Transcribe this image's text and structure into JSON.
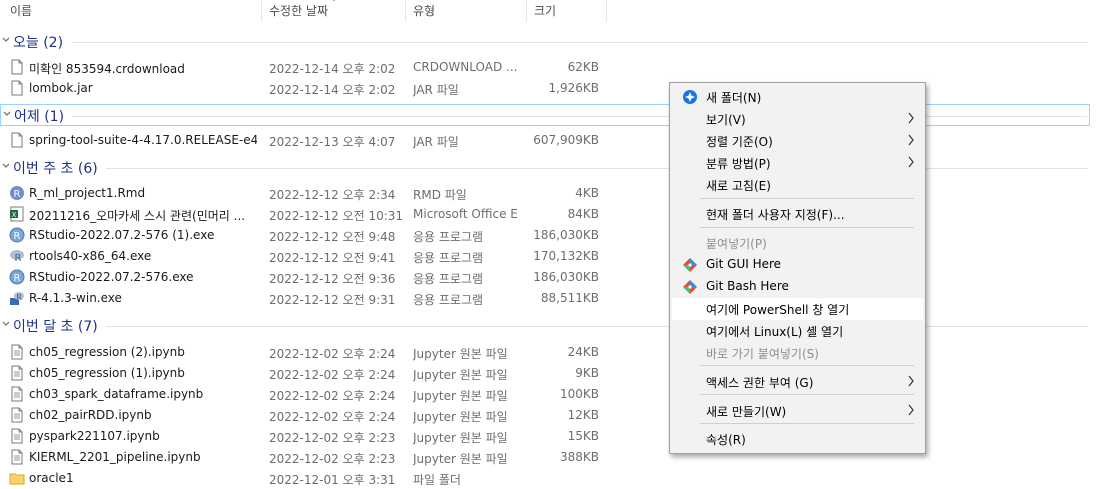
{
  "columns": {
    "name": "이름",
    "date": "수정한 날짜",
    "type": "유형",
    "size": "크기"
  },
  "groups": [
    {
      "title": "오늘 (2)",
      "rows": [
        {
          "name": "미확인 853594.crdownload",
          "date": "2022-12-14 오후 2:02",
          "type": "CRDOWNLOAD ...",
          "size": "62KB",
          "icon": "blank-file-icon"
        },
        {
          "name": "lombok.jar",
          "date": "2022-12-14 오후 2:02",
          "type": "JAR 파일",
          "size": "1,926KB",
          "icon": "blank-file-icon"
        }
      ]
    },
    {
      "title": "어제 (1)",
      "rows": [
        {
          "name": "spring-tool-suite-4-4.17.0.RELEASE-e4.2...",
          "date": "2022-12-13 오후 4:07",
          "type": "JAR 파일",
          "size": "607,909KB",
          "icon": "blank-file-icon"
        }
      ]
    },
    {
      "title": "이번 주 초 (6)",
      "rows": [
        {
          "name": "R_ml_project1.Rmd",
          "date": "2022-12-12 오후 2:34",
          "type": "RMD 파일",
          "size": "4KB",
          "icon": "r-markdown-icon"
        },
        {
          "name": "20211216_오마카세 스시 관련(민머리 ...",
          "date": "2022-12-12 오전 10:31",
          "type": "Microsoft Office E...",
          "size": "84KB",
          "icon": "excel-file-icon"
        },
        {
          "name": "RStudio-2022.07.2-576 (1).exe",
          "date": "2022-12-12 오전 9:48",
          "type": "응용 프로그램",
          "size": "186,030KB",
          "icon": "rstudio-icon"
        },
        {
          "name": "rtools40-x86_64.exe",
          "date": "2022-12-12 오전 9:41",
          "type": "응용 프로그램",
          "size": "170,132KB",
          "icon": "r-installer-icon"
        },
        {
          "name": "RStudio-2022.07.2-576.exe",
          "date": "2022-12-12 오전 9:36",
          "type": "응용 프로그램",
          "size": "186,030KB",
          "icon": "rstudio-icon"
        },
        {
          "name": "R-4.1.3-win.exe",
          "date": "2022-12-12 오전 9:31",
          "type": "응용 프로그램",
          "size": "88,511KB",
          "icon": "r-setup-icon"
        }
      ]
    },
    {
      "title": "이번 달 초 (7)",
      "rows": [
        {
          "name": "ch05_regression (2).ipynb",
          "date": "2022-12-02 오후 2:24",
          "type": "Jupyter 원본 파일",
          "size": "24KB",
          "icon": "text-file-icon"
        },
        {
          "name": "ch05_regression (1).ipynb",
          "date": "2022-12-02 오후 2:24",
          "type": "Jupyter 원본 파일",
          "size": "9KB",
          "icon": "text-file-icon"
        },
        {
          "name": "ch03_spark_dataframe.ipynb",
          "date": "2022-12-02 오후 2:24",
          "type": "Jupyter 원본 파일",
          "size": "100KB",
          "icon": "text-file-icon"
        },
        {
          "name": "ch02_pairRDD.ipynb",
          "date": "2022-12-02 오후 2:24",
          "type": "Jupyter 원본 파일",
          "size": "12KB",
          "icon": "text-file-icon"
        },
        {
          "name": "pyspark221107.ipynb",
          "date": "2022-12-02 오후 2:23",
          "type": "Jupyter 원본 파일",
          "size": "15KB",
          "icon": "text-file-icon"
        },
        {
          "name": "KIERML_2201_pipeline.ipynb",
          "date": "2022-12-02 오후 2:23",
          "type": "Jupyter 원본 파일",
          "size": "388KB",
          "icon": "text-file-icon"
        },
        {
          "name": "oracle1",
          "date": "2022-12-01 오후 3:31",
          "type": "파일 폴더",
          "size": "",
          "icon": "folder-icon"
        }
      ]
    }
  ],
  "context_menu": {
    "items": [
      {
        "label": "새 폴더(N)",
        "icon": "new-folder-icon",
        "disabled": false,
        "submenu": false
      },
      {
        "label": "보기(V)",
        "disabled": false,
        "submenu": true
      },
      {
        "label": "정렬 기준(O)",
        "disabled": false,
        "submenu": true
      },
      {
        "label": "분류 방법(P)",
        "disabled": false,
        "submenu": true
      },
      {
        "label": "새로 고침(E)",
        "disabled": false,
        "submenu": false
      },
      {
        "label": "현재 폴더 사용자 지정(F)...",
        "disabled": false,
        "submenu": false
      },
      {
        "label": "붙여넣기(P)",
        "disabled": true,
        "submenu": false
      },
      {
        "label": "Git GUI Here",
        "icon": "git-icon",
        "disabled": false,
        "submenu": false
      },
      {
        "label": "Git Bash Here",
        "icon": "git-icon",
        "disabled": false,
        "submenu": false
      },
      {
        "label": "여기에 PowerShell 창 열기",
        "disabled": false,
        "submenu": false,
        "highlighted": true
      },
      {
        "label": "여기에서 Linux(L) 셸 열기",
        "disabled": false,
        "submenu": false
      },
      {
        "label": "바로 가기 붙여넣기(S)",
        "disabled": true,
        "submenu": false
      },
      {
        "label": "액세스 권한 부여 (G)",
        "disabled": false,
        "submenu": true
      },
      {
        "label": "새로 만들기(W)",
        "disabled": false,
        "submenu": true
      },
      {
        "label": "속성(R)",
        "disabled": false,
        "submenu": false
      }
    ]
  },
  "colors": {
    "group_title": "#1e3287",
    "menu_bg": "#f2f2f2",
    "focus_border": "#99d1ff"
  }
}
